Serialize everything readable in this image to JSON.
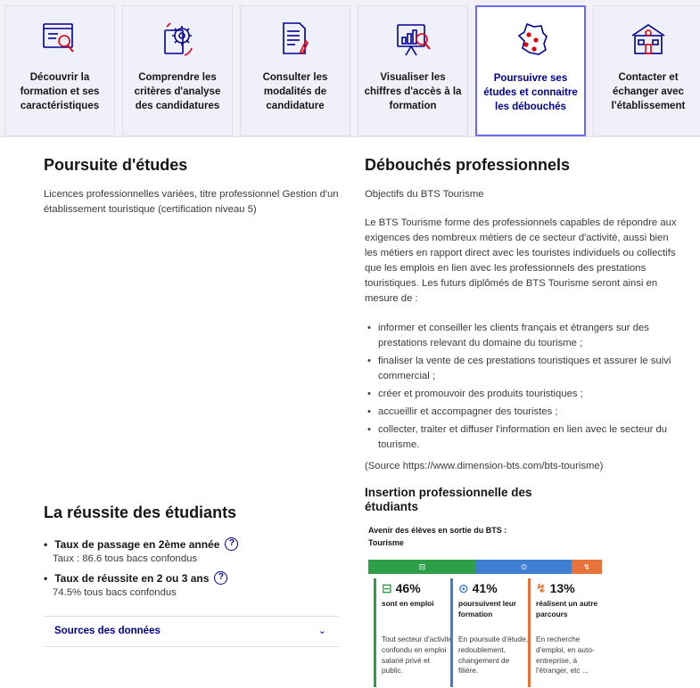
{
  "tabs": [
    {
      "label": "Découvrir la formation et ses caractéristiques",
      "icon": "document-search-icon"
    },
    {
      "label": "Comprendre les critères d'analyse des candidatures",
      "icon": "gear-document-icon"
    },
    {
      "label": "Consulter les modalités de candidature",
      "icon": "document-pen-icon"
    },
    {
      "label": "Visualiser les chiffres d'accès à la formation",
      "icon": "chart-board-icon"
    },
    {
      "label": "Poursuivre ses études et connaitre les débouchés",
      "icon": "france-map-icon",
      "active": true
    },
    {
      "label": "Contacter et échanger avec l'établissement",
      "icon": "school-building-icon"
    }
  ],
  "poursuite": {
    "title": "Poursuite d'études",
    "text": "Licences professionnelles variées, titre professionnel Gestion d'un établissement touristique (certification niveau 5)"
  },
  "debouches": {
    "title": "Débouchés professionnels",
    "objectifs": "Objectifs du BTS Tourisme",
    "intro": "Le BTS Tourisme forme des professionnels capables de répondre aux exigences des nombreux métiers de ce secteur d'activité, aussi bien les métiers en rapport direct avec les touristes individuels ou collectifs que les emplois en lien avec les professionnels des prestations touristiques. Les futurs diplômés de BTS Tourisme seront ainsi en mesure de :",
    "items": [
      "informer et conseiller les clients français et étrangers sur des prestations relevant du domaine du tourisme ;",
      "finaliser la vente de ces prestations touristiques et assurer le suivi commercial ;",
      "créer et promouvoir des produits touristiques ;",
      "accueillir et accompagner des touristes ;",
      "collecter, traiter et diffuser l'information en lien avec le secteur du tourisme."
    ],
    "source": "(Source https://www.dimension-bts.com/bts-tourisme)"
  },
  "reussite": {
    "title": "La réussite des étudiants",
    "passage_label": "Taux de passage en 2ème année",
    "passage_value": "Taux : 86.6 tous bacs confondus",
    "reussite_label": "Taux de réussite en 2 ou 3 ans",
    "reussite_value": "74.5% tous bacs confondus",
    "help_symbol": "?",
    "sources_label": "Sources des données",
    "chevron": "⌄"
  },
  "insertion": {
    "title": "Insertion professionnelle des étudiants",
    "avenir": "Avenir des élèves en sortie du BTS : Tourisme",
    "bar_icons": [
      "⊟",
      "⊙",
      "↯"
    ],
    "columns": [
      {
        "icon": "⊟",
        "pct": "46%",
        "sub": "sont en emploi",
        "desc": "Tout secteur d'activité confondu en emploi salarié privé et public.",
        "color": "#2e9e48",
        "share": 46
      },
      {
        "icon": "⊙",
        "pct": "41%",
        "sub": "poursuivent leur formation",
        "desc": "En poursuite d'étude, redoublement, changement de filière.",
        "color": "#3f7fd1",
        "share": 41
      },
      {
        "icon": "↯",
        "pct": "13%",
        "sub": "réalisent un autre parcours",
        "desc": "En recherche d'emploi, en auto-entreprise, à l'étranger, etc ...",
        "color": "#e8733a",
        "share": 13
      }
    ]
  }
}
